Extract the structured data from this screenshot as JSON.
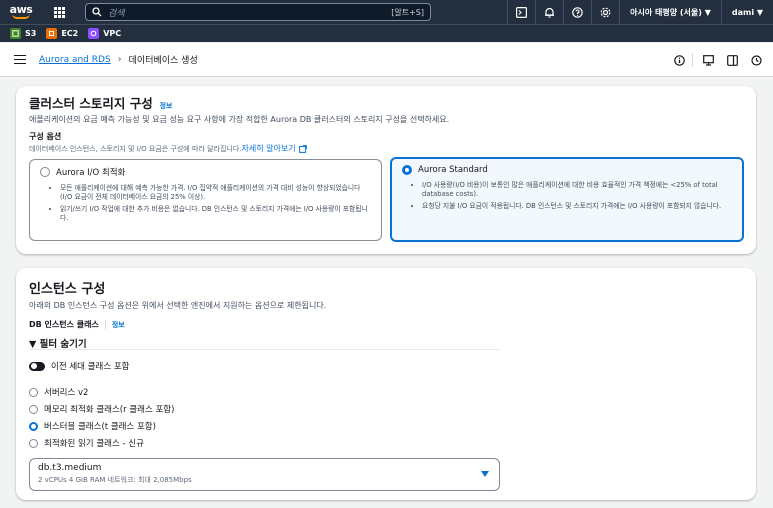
{
  "topnav": {
    "logo": "aws",
    "search_placeholder": "검색",
    "search_shortcut": "[알트+S]",
    "region": "아시아 태평양 (서울) ▼",
    "user": "dami ▼"
  },
  "favorites": [
    {
      "label": "S3",
      "color": "#3f8624"
    },
    {
      "label": "EC2",
      "color": "#ed7100"
    },
    {
      "label": "VPC",
      "color": "#8c4fff"
    }
  ],
  "breadcrumb": {
    "parent": "Aurora and RDS",
    "current": "데이터베이스 생성"
  },
  "storage": {
    "title": "클러스터 스토리지 구성",
    "info": "정보",
    "description": "애플리케이션의 요금 예측 가능성 및 요금 성능 요구 사항에 가장 적합한 Aurora DB 클러스터의 스토리지 구성을 선택하세요.",
    "options_label": "구성 옵션",
    "options_sub": "데이터베이스 인스턴스, 스토리지 및 I/O 요금은 구성에 따라 달라집니다.",
    "learn_more": "자세히 알아보기",
    "tiles": [
      {
        "title": "Aurora I/O 최적화",
        "bullets": [
          "모든 애플리케이션에 대해 예측 가능한 가격. I/O 집약적 애플리케이션의 가격 대비 성능이 향상되었습니다(I/O 요금이 전체 데이터베이스 요금의 25% 이상).",
          "읽기/쓰기 I/O 작업에 대한 추가 비용은 없습니다. DB 인스턴스 및 스토리지 가격에는 I/O 사용량이 포함됩니다."
        ]
      },
      {
        "title": "Aurora Standard",
        "bullets": [
          "I/O 사용량(I/O 비용)이 보통인 많은 애플리케이션에 대한 비용 효율적인 가격 책정에는 <25% of total database costs).",
          "요청당 지불 I/O 요금이 적용됩니다. DB 인스턴스 및 스토리지 가격에는 I/O 사용량이 포함되지 않습니다."
        ]
      }
    ],
    "selected_tile": 1
  },
  "instance": {
    "title": "인스턴스 구성",
    "description": "아래의 DB 인스턴스 구성 옵션은 위에서 선택한 엔진에서 지원하는 옵션으로 제한됩니다.",
    "class_label": "DB 인스턴스 클래스",
    "info": "정보",
    "filter_toggle": "▼ 필터 숨기기",
    "prev_gen_label": "이전 세대 클래스 포함",
    "class_options": [
      "서버리스 v2",
      "메모리 최적화 클래스(r 클래스 포함)",
      "버스터블 클래스(t 클래스 포함)",
      "최적화된 읽기 클래스 - 신규"
    ],
    "selected_class": 2,
    "select_value": "db.t3.medium",
    "select_detail": "2 vCPUs    4 GiB RAM    네트워크: 최대 2,085Mbps"
  }
}
